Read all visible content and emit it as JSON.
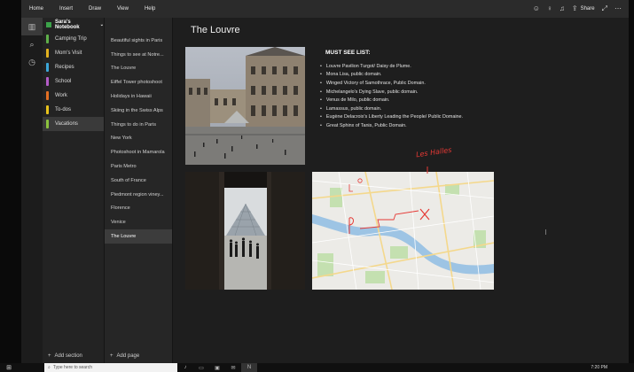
{
  "menubar": {
    "items": [
      "Home",
      "Insert",
      "Draw",
      "View",
      "Help"
    ],
    "share_label": "Share"
  },
  "notebook": {
    "title": "Sara's Notebook"
  },
  "sections": [
    {
      "label": "Camping Trip",
      "color": "#5fb04a"
    },
    {
      "label": "Mom's Visit",
      "color": "#e3b21f"
    },
    {
      "label": "Recipes",
      "color": "#3ba6d8"
    },
    {
      "label": "School",
      "color": "#b45cc8"
    },
    {
      "label": "Work",
      "color": "#e36f23"
    },
    {
      "label": "To-dos",
      "color": "#e8c31c"
    },
    {
      "label": "Vacations",
      "color": "#8cc23e"
    }
  ],
  "active_section": 6,
  "add_section_label": "Add section",
  "pages": [
    "Beautiful sights in Paris",
    "Things to see at Notre...",
    "The Louvre",
    "Eiffel Tower photoshoot",
    "Holidays in Hawaii",
    "Skiing in the Swiss Alps",
    "Things to do in Paris",
    "New York",
    "Photoshoot in Mamarola",
    "Paris Metro",
    "South of France",
    "Piedmont region viney...",
    "Florence",
    "Venice",
    "The Louvre"
  ],
  "active_page": 14,
  "add_page_label": "Add page",
  "canvas": {
    "title": "The Louvre",
    "list_title": "MUST SEE LIST:",
    "list_items": [
      "Louvre Pavilion Turgot/ Daisy de Plume.",
      "Mona Lisa, public domain.",
      "Winged Victory of Samothrace, Public Domain.",
      "Michelangelo's Dying Slave, public domain.",
      "Venus de Milo, public domain.",
      "Lamassus, public domain.",
      "Eugène Delacroix's Liberty Leading the People/ Public Domaine.",
      "Great Sphinx of Tanis, Public Domain."
    ],
    "ink_label": "Les Halles"
  },
  "taskbar": {
    "search_placeholder": "Type here to search",
    "time": "7:20 PM"
  }
}
